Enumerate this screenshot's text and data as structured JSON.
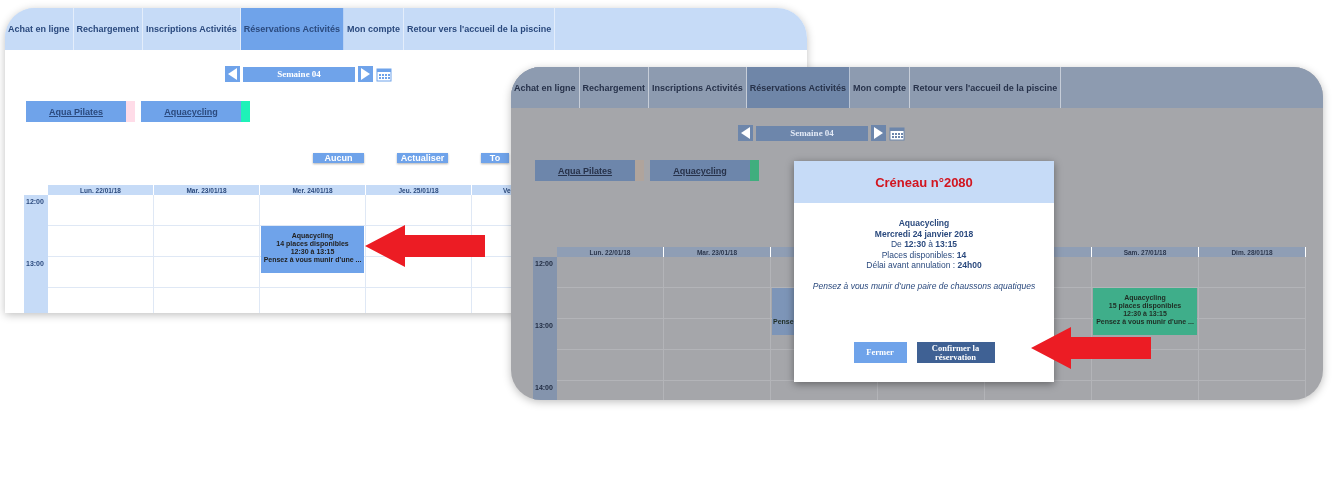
{
  "screens": [
    {
      "dimmed": false,
      "tabs": [
        {
          "label": "Achat en ligne",
          "selected": false
        },
        {
          "label": "Rechargement",
          "selected": false
        },
        {
          "label": "Inscriptions Activités",
          "selected": false
        },
        {
          "label": "Réservations Activités",
          "selected": true
        },
        {
          "label": "Mon compte",
          "selected": false
        },
        {
          "label": "Retour vers l'accueil de la piscine",
          "selected": false
        }
      ],
      "week": "Semaine 04",
      "filters": [
        {
          "label": "Aqua Pilates",
          "color": "#ffdce8"
        },
        {
          "label": "Aquacycling",
          "color": "#1ef2b8"
        }
      ],
      "actions": [
        {
          "label": "Aucun",
          "kind": "full"
        },
        {
          "label": "Actualiser",
          "kind": "full"
        },
        {
          "label": "To",
          "kind": "cut"
        }
      ],
      "times": [
        "12:00",
        "13:00"
      ],
      "days": [
        {
          "label": "Lun. 22/01/18",
          "kind": "full"
        },
        {
          "label": "Mar. 23/01/18",
          "kind": "full"
        },
        {
          "label": "Mer. 24/01/18",
          "kind": "full",
          "events": [
            {
              "kind": "full",
              "color": "#6fa3ea",
              "lines": [
                "Aquacycling",
                "14 places disponibles",
                "12:30 à 13:15",
                "Pensez à vous munir d'une ..."
              ]
            }
          ]
        },
        {
          "label": "Jeu. 25/01/18",
          "kind": "full"
        },
        {
          "label": "Ve",
          "kind": "cut"
        }
      ]
    },
    {
      "dimmed": true,
      "tabs": [
        {
          "label": "Achat en ligne",
          "selected": false
        },
        {
          "label": "Rechargement",
          "selected": false
        },
        {
          "label": "Inscriptions Activités",
          "selected": false
        },
        {
          "label": "Réservations Activités",
          "selected": true
        },
        {
          "label": "Mon compte",
          "selected": false
        },
        {
          "label": "Retour vers l'accueil de la piscine",
          "selected": false
        }
      ],
      "week": "Semaine 04",
      "filters": [
        {
          "label": "Aqua Pilates",
          "color": "#b0a49c"
        },
        {
          "label": "Aquacycling",
          "color": "#3fae7e"
        }
      ],
      "times": [
        "12:00",
        "13:00",
        "14:00"
      ],
      "days": [
        {
          "label": "Lun. 22/01/18",
          "kind": "full"
        },
        {
          "label": "Mar. 23/01/18",
          "kind": "full"
        },
        {
          "kind": "full",
          "events": [
            {
              "kind": "partial",
              "color": "#7d95b8",
              "lines": [
                "Pense"
              ]
            }
          ]
        },
        {
          "kind": "full"
        },
        {
          "kind": "full"
        },
        {
          "label": "Sam. 27/01/18",
          "kind": "full",
          "events": [
            {
              "kind": "full",
              "color": "#3fae8a",
              "lines": [
                "Aquacycling",
                "15 places disponibles",
                "12:30 à 13:15",
                "Pensez à vous munir d'une ..."
              ]
            }
          ]
        },
        {
          "label": "Dim. 28/01/18",
          "kind": "full"
        }
      ],
      "modal": {
        "title": "Créneau n°2080",
        "lines": [
          {
            "kind": "heading",
            "text": "Aquacycling"
          },
          {
            "kind": "heading",
            "text": "Mercredi 24 janvier 2018"
          },
          {
            "kind": "plain",
            "text": "De **12:30** à **13:15**"
          },
          {
            "kind": "plain",
            "text": "Places disponibles: **14**"
          },
          {
            "kind": "plain",
            "text": "Délai avant annulation : **24h00**"
          },
          {
            "kind": "note",
            "text": "Pensez à vous munir d'une paire de chaussons aquatiques"
          }
        ],
        "buttons": [
          {
            "label": "Fermer",
            "kind": "secondary"
          },
          {
            "label": "Confirmer la réservation",
            "kind": "primary"
          }
        ]
      }
    }
  ]
}
